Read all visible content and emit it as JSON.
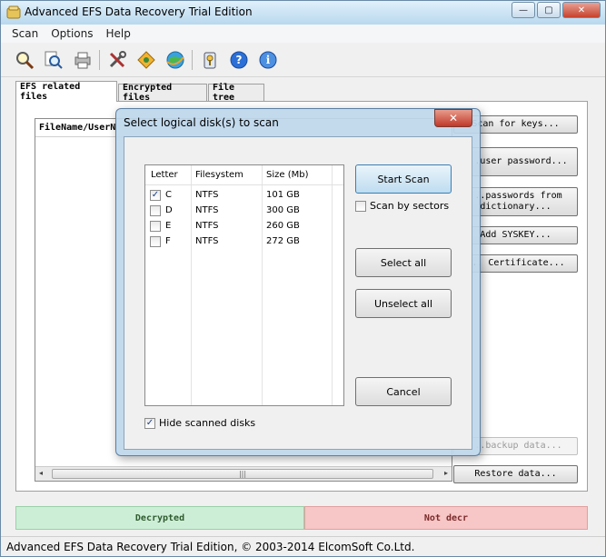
{
  "window": {
    "title": "Advanced EFS Data Recovery Trial Edition"
  },
  "menu": [
    "Scan",
    "Options",
    "Help"
  ],
  "tabs": [
    "EFS related files",
    "Encrypted files",
    "File tree"
  ],
  "list": {
    "header": "FileName/UserN"
  },
  "right_buttons": [
    "Scan for keys...",
    "...user password...",
    "...passwords from dictionary...",
    "Add SYSKEY...",
    "... Certificate...",
    "...backup data...",
    "Restore data..."
  ],
  "status": {
    "decrypted": "Decrypted",
    "not_decrypted": "Not decr"
  },
  "statusbar": "Advanced EFS Data Recovery Trial Edition, © 2003-2014 ElcomSoft Co.Ltd.",
  "dialog": {
    "title": "Select logical disk(s) to scan",
    "columns": [
      "Letter",
      "Filesystem",
      "Size (Mb)"
    ],
    "disks": [
      {
        "letter": "C",
        "fs": "NTFS",
        "size": "101 GB",
        "checked": true
      },
      {
        "letter": "D",
        "fs": "NTFS",
        "size": "300 GB",
        "checked": false
      },
      {
        "letter": "E",
        "fs": "NTFS",
        "size": "260 GB",
        "checked": false
      },
      {
        "letter": "F",
        "fs": "NTFS",
        "size": "272 GB",
        "checked": false
      }
    ],
    "start_scan": "Start Scan",
    "scan_by_sectors": "Scan by sectors",
    "select_all": "Select all",
    "unselect_all": "Unselect all",
    "cancel": "Cancel",
    "hide_scanned": "Hide scanned disks"
  },
  "toolbar_icons": [
    "scan-icon",
    "search-icon",
    "printer-icon",
    "tools-icon",
    "recover-icon",
    "internet-icon",
    "keys-icon",
    "help-icon",
    "info-icon"
  ],
  "colors": {
    "accent": "#3c7fb1",
    "decrypted_bg": "#cdeed6",
    "notdecrypted_bg": "#f7c6c6"
  }
}
